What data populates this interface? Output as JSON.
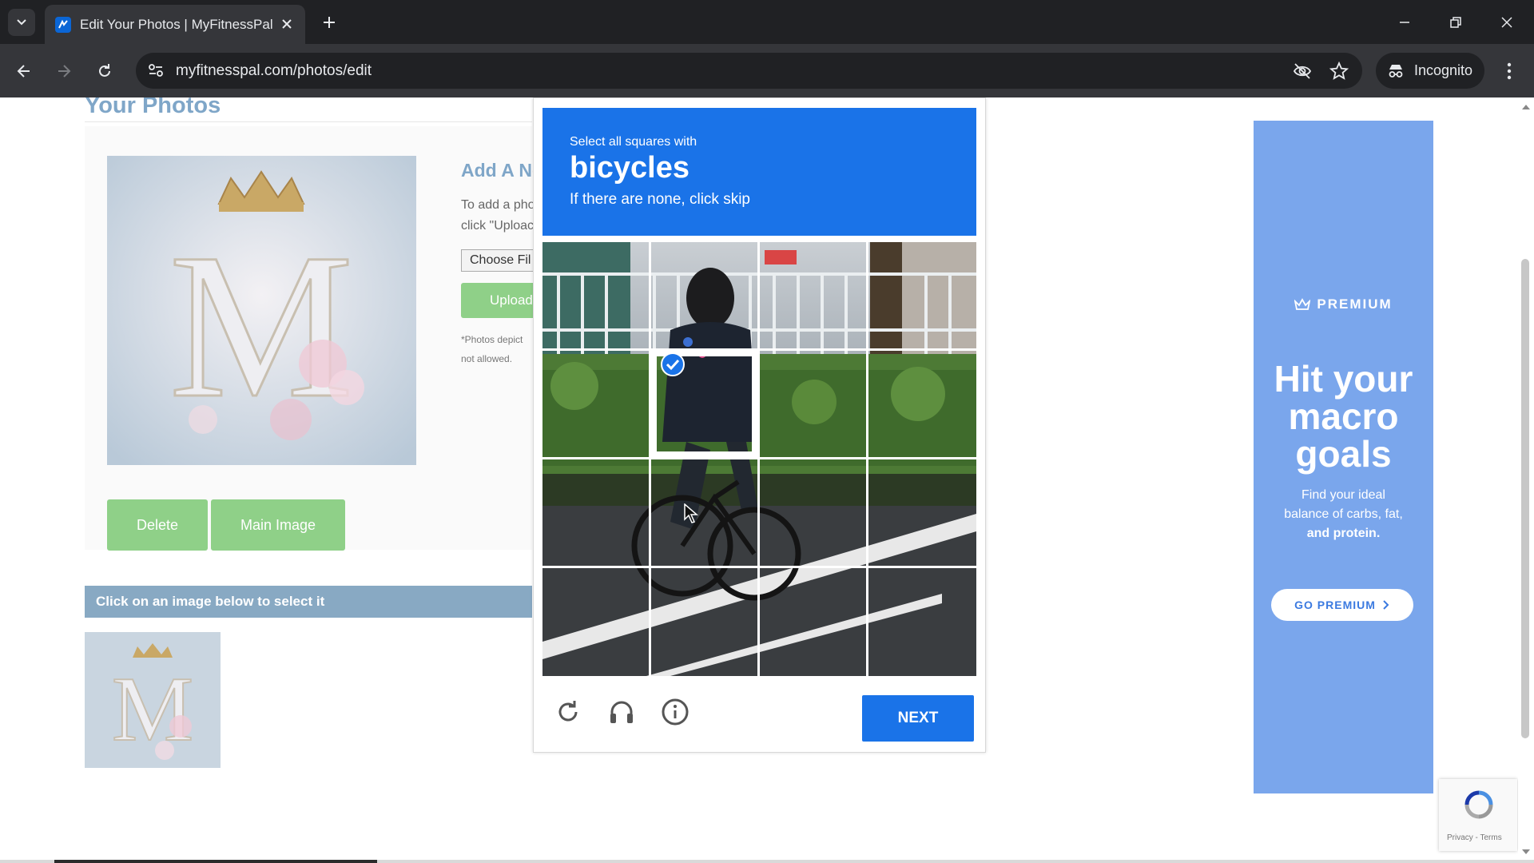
{
  "browser": {
    "tab_title": "Edit Your Photos | MyFitnessPal",
    "url": "myfitnesspal.com/photos/edit",
    "profile_label": "Incognito"
  },
  "page": {
    "title": "Your Photos",
    "add_title": "Add A Ne",
    "add_text_line1": "To add a pho",
    "add_text_line2": "click \"Uploac",
    "choose_file_label": "Choose Fil",
    "upload_label": "Upload",
    "note_line1": "*Photos depict",
    "note_line2": "not allowed.",
    "delete_label": "Delete",
    "main_image_label": "Main Image",
    "select_bar_text": "Click on an image below to select it"
  },
  "captcha": {
    "instruction": "Select all squares with",
    "target": "bicycles",
    "hint": "If there are none, click skip",
    "next_label": "NEXT"
  },
  "ad": {
    "brand": "PREMIUM",
    "headline_1": "Hit your",
    "headline_2": "macro",
    "headline_3": "goals",
    "sub_1": "Find your ideal",
    "sub_2": "balance of carbs, fat,",
    "sub_3": "and protein.",
    "cta": "GO PREMIUM"
  },
  "recaptcha_badge": {
    "links": "Privacy - Terms"
  },
  "colors": {
    "captcha_blue": "#1a73e8",
    "green_button": "#8fd088",
    "ad_blue": "#7aa6ec",
    "title_blue": "#7fa6c8"
  }
}
